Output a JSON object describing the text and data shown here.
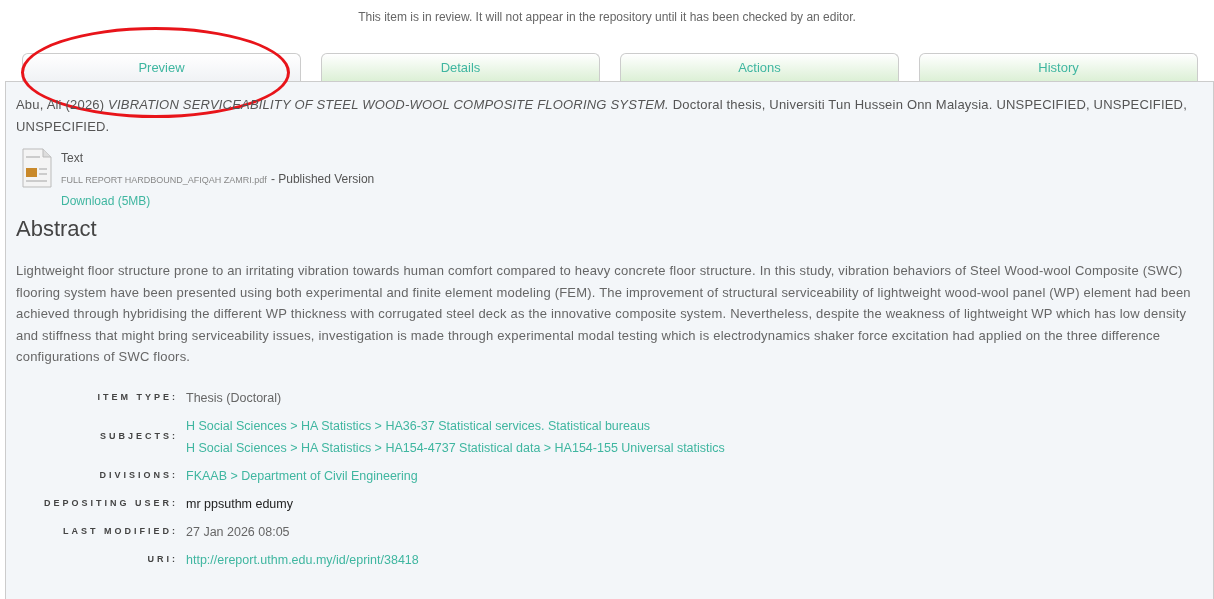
{
  "notice": "This item is in review. It will not appear in the repository until it has been checked by an editor.",
  "tabs": [
    {
      "label": "Preview",
      "selected": true
    },
    {
      "label": "Details",
      "selected": false
    },
    {
      "label": "Actions",
      "selected": false
    },
    {
      "label": "History",
      "selected": false
    }
  ],
  "citation": "Abu, Ali (2026) *VIBRATION SERVICEABILITY OF STEEL WOOD-WOOL COMPOSITE FLOORING SYSTEM.* Doctoral thesis, Universiti Tun Hussein Onn Malaysia. UNSPECIFIED, UNSPECIFIED, UNSPECIFIED.",
  "document": {
    "type": "Text",
    "filename": "FULL REPORT HARDBOUND_AFIQAH ZAMRI.pdf",
    "version": "- Published Version",
    "download": "Download (5MB)"
  },
  "abstract": {
    "heading": "Abstract",
    "text": "Lightweight floor structure prone to an irritating vibration towards human comfort compared to heavy concrete floor structure. In this study, vibration behaviors of Steel Wood-wool Composite (SWC) flooring system have been presented using both experimental and finite element modeling (FEM). The improvement of structural serviceability of lightweight wood-wool panel (WP) element had been achieved through hybridising the different WP thickness with corrugated steel deck as the innovative composite system. Nevertheless, despite the weakness of lightweight WP which has low density and stiffness that might bring serviceability issues, investigation is made through experimental modal testing which is electrodynamics shaker force excitation had applied on the three difference configurations of SWC floors."
  },
  "fields": [
    {
      "label": "ITEM TYPE:",
      "kind": "text",
      "values": [
        "Thesis (Doctoral)"
      ]
    },
    {
      "label": "SUBJECTS:",
      "kind": "link",
      "values": [
        "H Social Sciences > HA Statistics > HA36-37 Statistical services. Statistical bureaus",
        "H Social Sciences > HA Statistics > HA154-4737 Statistical data > HA154-155 Universal statistics"
      ]
    },
    {
      "label": "DIVISIONS:",
      "kind": "link",
      "values": [
        "FKAAB > Department of Civil Engineering"
      ]
    },
    {
      "label": "DEPOSITING USER:",
      "kind": "user",
      "values": [
        "mr ppsuthm edumy"
      ]
    },
    {
      "label": "LAST MODIFIED:",
      "kind": "text",
      "values": [
        "27 Jan 2026 08:05"
      ]
    },
    {
      "label": "URI:",
      "kind": "link",
      "values": [
        "http://ereport.uthm.edu.my/id/eprint/38418"
      ]
    }
  ]
}
